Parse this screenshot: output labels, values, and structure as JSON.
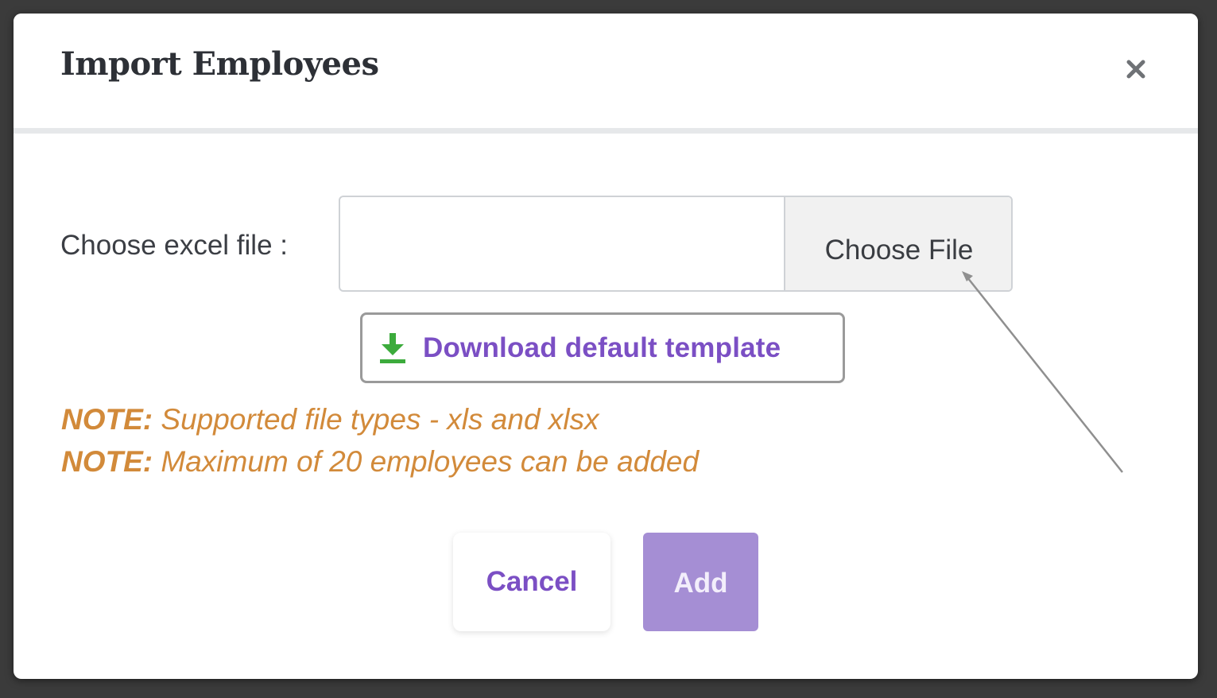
{
  "modal": {
    "title": "Import Employees",
    "close_icon": "close-icon"
  },
  "form": {
    "label": "Choose excel file :",
    "file_value": "",
    "choose_button": "Choose File"
  },
  "download": {
    "icon": "download-icon",
    "label": "Download default template"
  },
  "notes": [
    {
      "prefix": "NOTE:",
      "text": " Supported file types - xls and xlsx"
    },
    {
      "prefix": "NOTE:",
      "text": " Maximum of 20 employees can be added"
    }
  ],
  "actions": {
    "cancel": "Cancel",
    "add": "Add"
  },
  "colors": {
    "accent": "#7b4fc4",
    "add_button": "#a58ed4",
    "note": "#d28a3a",
    "download_icon": "#3cab3c"
  }
}
